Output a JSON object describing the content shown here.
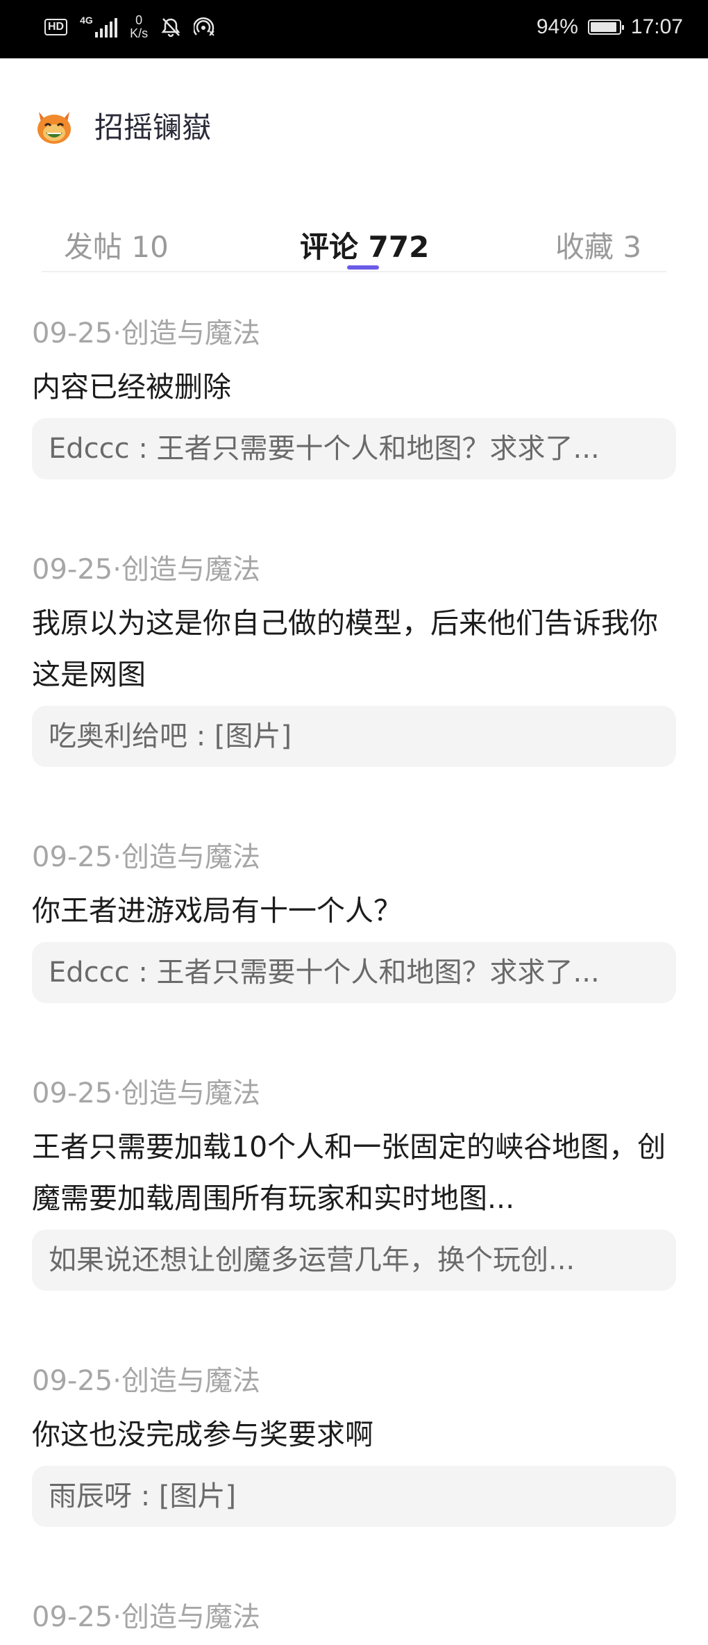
{
  "status_bar": {
    "hd": "HD",
    "network": "4G",
    "speed_value": "0",
    "speed_unit": "K/s",
    "battery_percent": "94%",
    "time": "17:07",
    "battery_level": 0.94,
    "icons": [
      "hd-icon",
      "signal-icon",
      "mute-icon",
      "hotspot-icon",
      "battery-icon"
    ]
  },
  "header": {
    "avatar_icon": "cat-emoji-avatar",
    "username": "招摇镧嶽"
  },
  "tabs": [
    {
      "label": "发帖 10",
      "active": false
    },
    {
      "label": "评论 772",
      "active": true
    },
    {
      "label": "收藏 3",
      "active": false
    }
  ],
  "comments": [
    {
      "meta": "09-25·创造与魔法",
      "content": "内容已经被删除",
      "quote": "Edccc : 王者只需要十个人和地图？求求了..."
    },
    {
      "meta": "09-25·创造与魔法",
      "content": "我原以为这是你自己做的模型，后来他们告诉我你这是网图",
      "quote": "吃奥利给吧 : [图片]"
    },
    {
      "meta": "09-25·创造与魔法",
      "content": "你王者进游戏局有十一个人？",
      "quote": "Edccc : 王者只需要十个人和地图？求求了..."
    },
    {
      "meta": "09-25·创造与魔法",
      "content": "王者只需要加载10个人和一张固定的峡谷地图，创魔需要加载周围所有玩家和实时地图...",
      "quote": "如果说还想让创魔多运营几年，换个玩创..."
    },
    {
      "meta": "09-25·创造与魔法",
      "content": "你这也没完成参与奖要求啊",
      "quote": "雨辰呀 : [图片]"
    },
    {
      "meta": "09-25·创造与魔法"
    }
  ],
  "colors": {
    "accent": "#6b5ce7",
    "meta_text": "#a6a6a6",
    "quote_bg": "#f4f4f5"
  }
}
